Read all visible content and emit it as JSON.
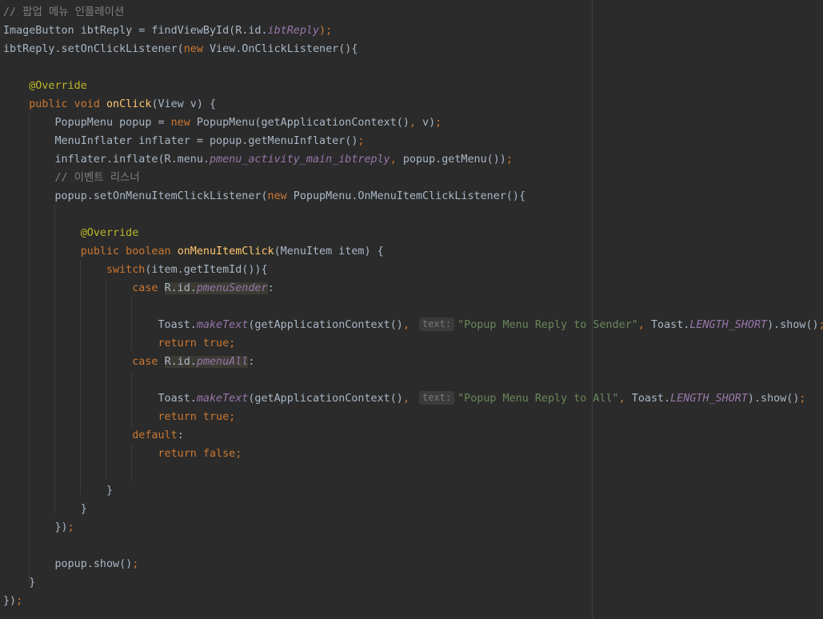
{
  "editor": {
    "lines": [
      [
        {
          "t": "// 팝업 메뉴 인플레이션",
          "c": "comment"
        }
      ],
      [
        {
          "t": "ImageButton ibtReply = findViewById(R.id."
        },
        {
          "t": "ibtReply",
          "c": "field"
        },
        {
          "t": ");",
          "c": "kw"
        }
      ],
      [
        {
          "t": "ibtReply.setOnClickListener("
        },
        {
          "t": "new",
          "c": "kw"
        },
        {
          "t": " View.OnClickListener(){"
        }
      ],
      [],
      [
        {
          "t": "    "
        },
        {
          "t": "@Override",
          "c": "ann"
        }
      ],
      [
        {
          "t": "    "
        },
        {
          "t": "public void",
          "c": "kw"
        },
        {
          "t": " "
        },
        {
          "t": "onClick",
          "c": "fn"
        },
        {
          "t": "(View v) {"
        }
      ],
      [
        {
          "t": "        PopupMenu popup = "
        },
        {
          "t": "new",
          "c": "kw"
        },
        {
          "t": " PopupMenu(getApplicationContext()"
        },
        {
          "t": ",",
          "c": "kw"
        },
        {
          "t": " v)"
        },
        {
          "t": ";",
          "c": "kw"
        }
      ],
      [
        {
          "t": "        MenuInflater inflater = popup.getMenuInflater()"
        },
        {
          "t": ";",
          "c": "kw"
        }
      ],
      [
        {
          "t": "        inflater.inflate(R.menu."
        },
        {
          "t": "pmenu_activity_main_ibtreply",
          "c": "field"
        },
        {
          "t": ",",
          "c": "kw"
        },
        {
          "t": " popup.getMenu())"
        },
        {
          "t": ";",
          "c": "kw"
        }
      ],
      [
        {
          "t": "        // 이벤트 리스너",
          "c": "comment"
        }
      ],
      [
        {
          "t": "        popup.setOnMenuItemClickListener("
        },
        {
          "t": "new",
          "c": "kw"
        },
        {
          "t": " PopupMenu.OnMenuItemClickListener(){"
        }
      ],
      [],
      [
        {
          "t": "            "
        },
        {
          "t": "@Override",
          "c": "ann"
        }
      ],
      [
        {
          "t": "            "
        },
        {
          "t": "public boolean",
          "c": "kw"
        },
        {
          "t": " "
        },
        {
          "t": "onMenuItemClick",
          "c": "fn"
        },
        {
          "t": "(MenuItem item) {"
        }
      ],
      [
        {
          "t": "                "
        },
        {
          "t": "switch",
          "c": "kw"
        },
        {
          "t": "(item.getItemId()){"
        }
      ],
      [
        {
          "t": "                    "
        },
        {
          "t": "case",
          "c": "kw"
        },
        {
          "t": " "
        },
        {
          "t": "R.id.",
          "c": "caret-hl"
        },
        {
          "t": "pmenuSender",
          "c": "field caret-hl"
        },
        {
          "t": ":"
        }
      ],
      [],
      [
        {
          "t": "                        Toast."
        },
        {
          "t": "makeText",
          "c": "field"
        },
        {
          "t": "(getApplicationContext()"
        },
        {
          "t": ",",
          "c": "kw"
        },
        {
          "t": " "
        },
        {
          "t": "text:",
          "c": "hint"
        },
        {
          "t": "\"Popup Menu Reply to Sender\"",
          "c": "str"
        },
        {
          "t": ",",
          "c": "kw"
        },
        {
          "t": " Toast."
        },
        {
          "t": "LENGTH_SHORT",
          "c": "field"
        },
        {
          "t": ").show()"
        },
        {
          "t": ";",
          "c": "kw"
        }
      ],
      [
        {
          "t": "                        "
        },
        {
          "t": "return true",
          "c": "kw"
        },
        {
          "t": ";",
          "c": "kw"
        }
      ],
      [
        {
          "t": "                    "
        },
        {
          "t": "case",
          "c": "kw"
        },
        {
          "t": " "
        },
        {
          "t": "R.id.",
          "c": "caret-hl"
        },
        {
          "t": "pmenuAll",
          "c": "field caret-hl"
        },
        {
          "t": ":"
        }
      ],
      [],
      [
        {
          "t": "                        Toast."
        },
        {
          "t": "makeText",
          "c": "field"
        },
        {
          "t": "(getApplicationContext()"
        },
        {
          "t": ",",
          "c": "kw"
        },
        {
          "t": " "
        },
        {
          "t": "text:",
          "c": "hint"
        },
        {
          "t": "\"Popup Menu Reply to All\"",
          "c": "str"
        },
        {
          "t": ",",
          "c": "kw"
        },
        {
          "t": " Toast."
        },
        {
          "t": "LENGTH_SHORT",
          "c": "field"
        },
        {
          "t": ").show()"
        },
        {
          "t": ";",
          "c": "kw"
        }
      ],
      [
        {
          "t": "                        "
        },
        {
          "t": "return true",
          "c": "kw"
        },
        {
          "t": ";",
          "c": "kw"
        }
      ],
      [
        {
          "t": "                    "
        },
        {
          "t": "default",
          "c": "kw"
        },
        {
          "t": ":"
        }
      ],
      [
        {
          "t": "                        "
        },
        {
          "t": "return false",
          "c": "kw"
        },
        {
          "t": ";",
          "c": "kw"
        }
      ],
      [],
      [
        {
          "t": "                }"
        }
      ],
      [
        {
          "t": "            }"
        }
      ],
      [
        {
          "t": "        })"
        },
        {
          "t": ";",
          "c": "kw"
        }
      ],
      [],
      [
        {
          "t": "        popup.show()"
        },
        {
          "t": ";",
          "c": "kw"
        }
      ],
      [
        {
          "t": "    }"
        }
      ],
      [
        {
          "t": "})"
        },
        {
          "t": ";",
          "c": "kw"
        }
      ]
    ]
  },
  "colors": {
    "background": "#2b2b2b",
    "text": "#a9b7c6",
    "keyword": "#cc7832",
    "annotation": "#bbb529",
    "method": "#ffc66d",
    "field": "#9876aa",
    "string": "#6a8759",
    "comment": "#808080"
  }
}
